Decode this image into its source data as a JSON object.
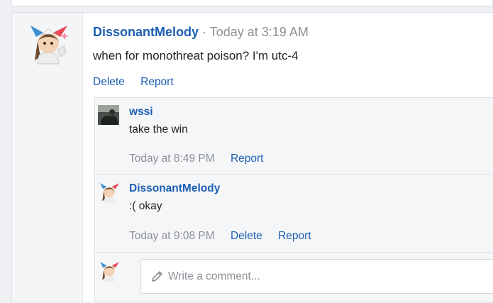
{
  "post": {
    "author": "DissonantMelody",
    "separator": "·",
    "timestamp": "Today at 3:19 AM",
    "body": "when for monothreat poison? I'm utc-4",
    "actions": {
      "delete": "Delete",
      "report": "Report"
    }
  },
  "comments": [
    {
      "author": "wssi",
      "text": "take the win",
      "timestamp": "Today at 8:49 PM",
      "actions": {
        "report": "Report"
      }
    },
    {
      "author": "DissonantMelody",
      "text": ":( okay",
      "timestamp": "Today at 9:08 PM",
      "actions": {
        "delete": "Delete",
        "report": "Report"
      }
    }
  ],
  "composer": {
    "placeholder": "Write a comment...",
    "icon": "pencil-icon"
  },
  "colors": {
    "link": "#1b5eb3",
    "muted": "#8c9096",
    "background": "#eef0f3",
    "comment_area": "#f5f6f8"
  }
}
